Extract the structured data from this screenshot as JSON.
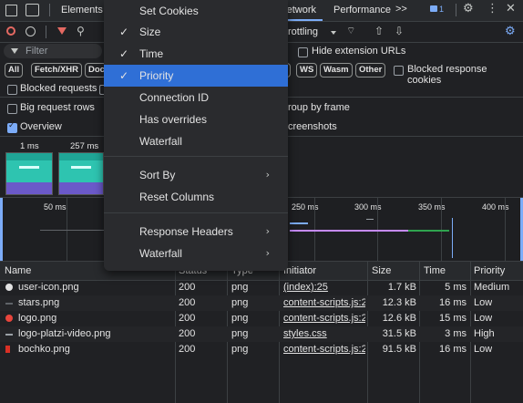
{
  "tabs": {
    "elements": "Elements",
    "network": "Network",
    "performance": "Performance",
    "more": ">>",
    "issues_count": "1"
  },
  "toolbar": {
    "throttling": "rottling"
  },
  "filter": {
    "placeholder": "Filter",
    "hide_ext": "Hide extension URLs"
  },
  "types": {
    "all": "All",
    "fetch": "Fetch/XHR",
    "doc": "Doc",
    "ws": "WS",
    "wasm": "Wasm",
    "other": "Other",
    "blocked_cookies": "Blocked response cookies"
  },
  "options": {
    "blocked_requests": "Blocked requests",
    "big_rows": "Big request rows",
    "group_frame": "roup by frame",
    "overview": "Overview",
    "screenshots": "creenshots"
  },
  "filmstrip": {
    "t1": "1 ms",
    "t2": "257 ms"
  },
  "timeline": {
    "ticks": [
      "50 ms",
      "250 ms",
      "300 ms",
      "350 ms",
      "400 ms"
    ]
  },
  "columns": {
    "name": "Name",
    "status": "Status",
    "type": "Type",
    "initiator": "Initiator",
    "size": "Size",
    "time": "Time",
    "priority": "Priority"
  },
  "rows": [
    {
      "name": "user-icon.png",
      "status": "200",
      "type": "png",
      "initiator": "(index):25",
      "size": "1.7 kB",
      "time": "5 ms",
      "priority": "Medium",
      "icon": "user-icon-thumb"
    },
    {
      "name": "stars.png",
      "status": "200",
      "type": "png",
      "initiator": "content-scripts.js:2",
      "size": "12.3 kB",
      "time": "16 ms",
      "priority": "Low",
      "icon": "stars-thumb"
    },
    {
      "name": "logo.png",
      "status": "200",
      "type": "png",
      "initiator": "content-scripts.js:2",
      "size": "12.6 kB",
      "time": "15 ms",
      "priority": "Low",
      "icon": "logo-thumb"
    },
    {
      "name": "logo-platzi-video.png",
      "status": "200",
      "type": "png",
      "initiator": "styles.css",
      "size": "31.5 kB",
      "time": "3 ms",
      "priority": "High",
      "icon": "platzi-thumb"
    },
    {
      "name": "bochko.png",
      "status": "200",
      "type": "png",
      "initiator": "content-scripts.js:2",
      "size": "91.5 kB",
      "time": "16 ms",
      "priority": "Low",
      "icon": "bochko-thumb"
    }
  ],
  "menu": {
    "items": [
      {
        "label": "Set Cookies",
        "checked": false
      },
      {
        "label": "Size",
        "checked": true
      },
      {
        "label": "Time",
        "checked": true
      },
      {
        "label": "Priority",
        "checked": true
      },
      {
        "label": "Connection ID",
        "checked": false
      },
      {
        "label": "Has overrides",
        "checked": false
      },
      {
        "label": "Waterfall",
        "checked": false
      }
    ],
    "sort_by": "Sort By",
    "reset_columns": "Reset Columns",
    "response_headers": "Response Headers",
    "waterfall_sub": "Waterfall",
    "check_glyph": "✓",
    "arrow_glyph": "›"
  },
  "colors": {
    "accent": "#7cacf8",
    "highlight": "#2f6fd6",
    "background": "#202124",
    "menu": "#2a2b2e"
  }
}
